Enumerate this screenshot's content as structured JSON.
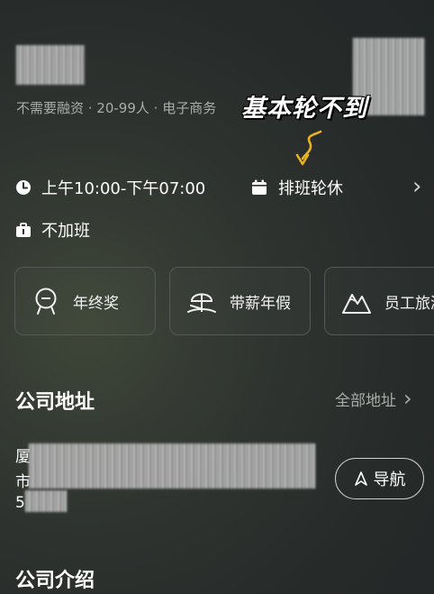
{
  "company": {
    "meta": "不需要融资 · 20-99人 · 电子商务"
  },
  "annotation": {
    "text": "基本轮不到"
  },
  "work_info": {
    "hours": "上午10:00-下午07:00",
    "schedule": "排班轮休",
    "overtime": "不加班",
    "chevron": "›"
  },
  "benefits": [
    {
      "label": "年终奖",
      "icon": "medal-icon"
    },
    {
      "label": "带薪年假",
      "icon": "beach-icon"
    },
    {
      "label": "员工旅游",
      "icon": "mountain-icon"
    }
  ],
  "address_section": {
    "title": "公司地址",
    "all_link": "全部地址",
    "nav_button": "导航",
    "lines": [
      "厦",
      "市",
      "5"
    ]
  },
  "intro_section": {
    "title": "公司介绍"
  },
  "colors": {
    "annotation_arrow": "#e8b21f",
    "muted_text": "#a9aca8"
  }
}
